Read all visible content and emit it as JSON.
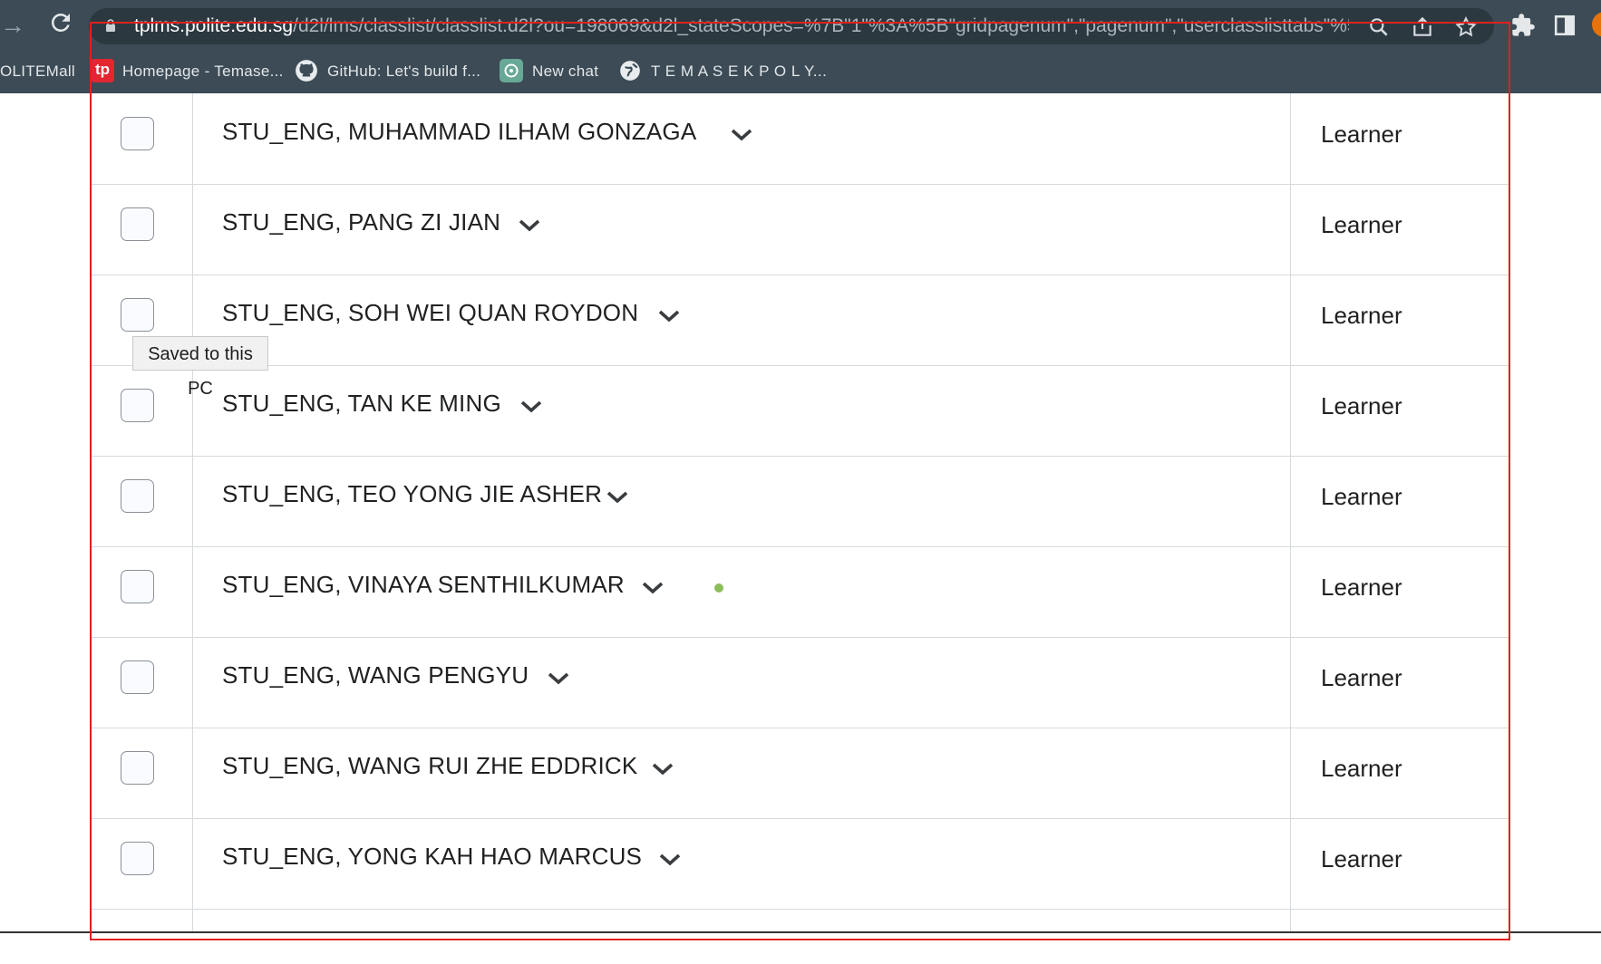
{
  "browser": {
    "url_host": "tplms.polite.edu.sg",
    "url_path": "/d2l/lms/classlist/classlist.d2l?ou=198069&d2l_stateScopes=%7B\"1\"%3A%5B\"gridpagenum\",\"pagenum\",\"userclasslisttabs\"%5D,...",
    "bookmarks": [
      {
        "label": "OLITEMall",
        "icon": "none"
      },
      {
        "label": "Homepage - Temase...",
        "icon": "tp-logo-icon"
      },
      {
        "label": "GitHub: Let's build f...",
        "icon": "github-icon"
      },
      {
        "label": "New chat",
        "icon": "chatgpt-icon"
      },
      {
        "label": "T E M A S E K P O L Y...",
        "icon": "globe-icon"
      }
    ]
  },
  "classlist": {
    "rows": [
      {
        "name": "STU_ENG, MUHAMMAD ILHAM GONZAGA",
        "role": "Learner"
      },
      {
        "name": "STU_ENG, PANG ZI JIAN",
        "role": "Learner"
      },
      {
        "name": "STU_ENG, SOH WEI QUAN ROYDON",
        "role": "Learner"
      },
      {
        "name": "STU_ENG, TAN KE MING",
        "role": "Learner"
      },
      {
        "name": "STU_ENG, TEO YONG JIE ASHER",
        "role": "Learner"
      },
      {
        "name": "STU_ENG, VINAYA SENTHILKUMAR",
        "role": "Learner"
      },
      {
        "name": "STU_ENG, WANG PENGYU",
        "role": "Learner"
      },
      {
        "name": "STU_ENG, WANG RUI ZHE EDDRICK",
        "role": "Learner"
      },
      {
        "name": "STU_ENG, YONG KAH HAO MARCUS",
        "role": "Learner"
      }
    ]
  },
  "tooltip": {
    "text": "Saved to this PC"
  },
  "colors": {
    "toolbar": "#3c4b55",
    "highlight": "#e02020",
    "online": "#8dbd5a"
  }
}
